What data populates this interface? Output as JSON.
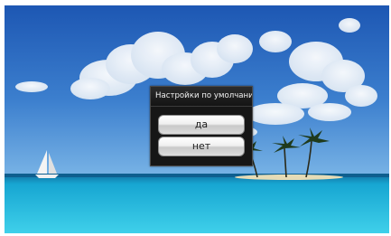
{
  "dialog": {
    "title": "Настройки по умолчанию",
    "yes_label": "да",
    "no_label": "нет"
  },
  "colors": {
    "dialog_background": "#161616",
    "button_face": "#e8e8e8",
    "sky": "#2f6fc4",
    "sea": "#1fb4d8"
  },
  "icons": {
    "wallpaper": "tropical-beach-wallpaper"
  }
}
